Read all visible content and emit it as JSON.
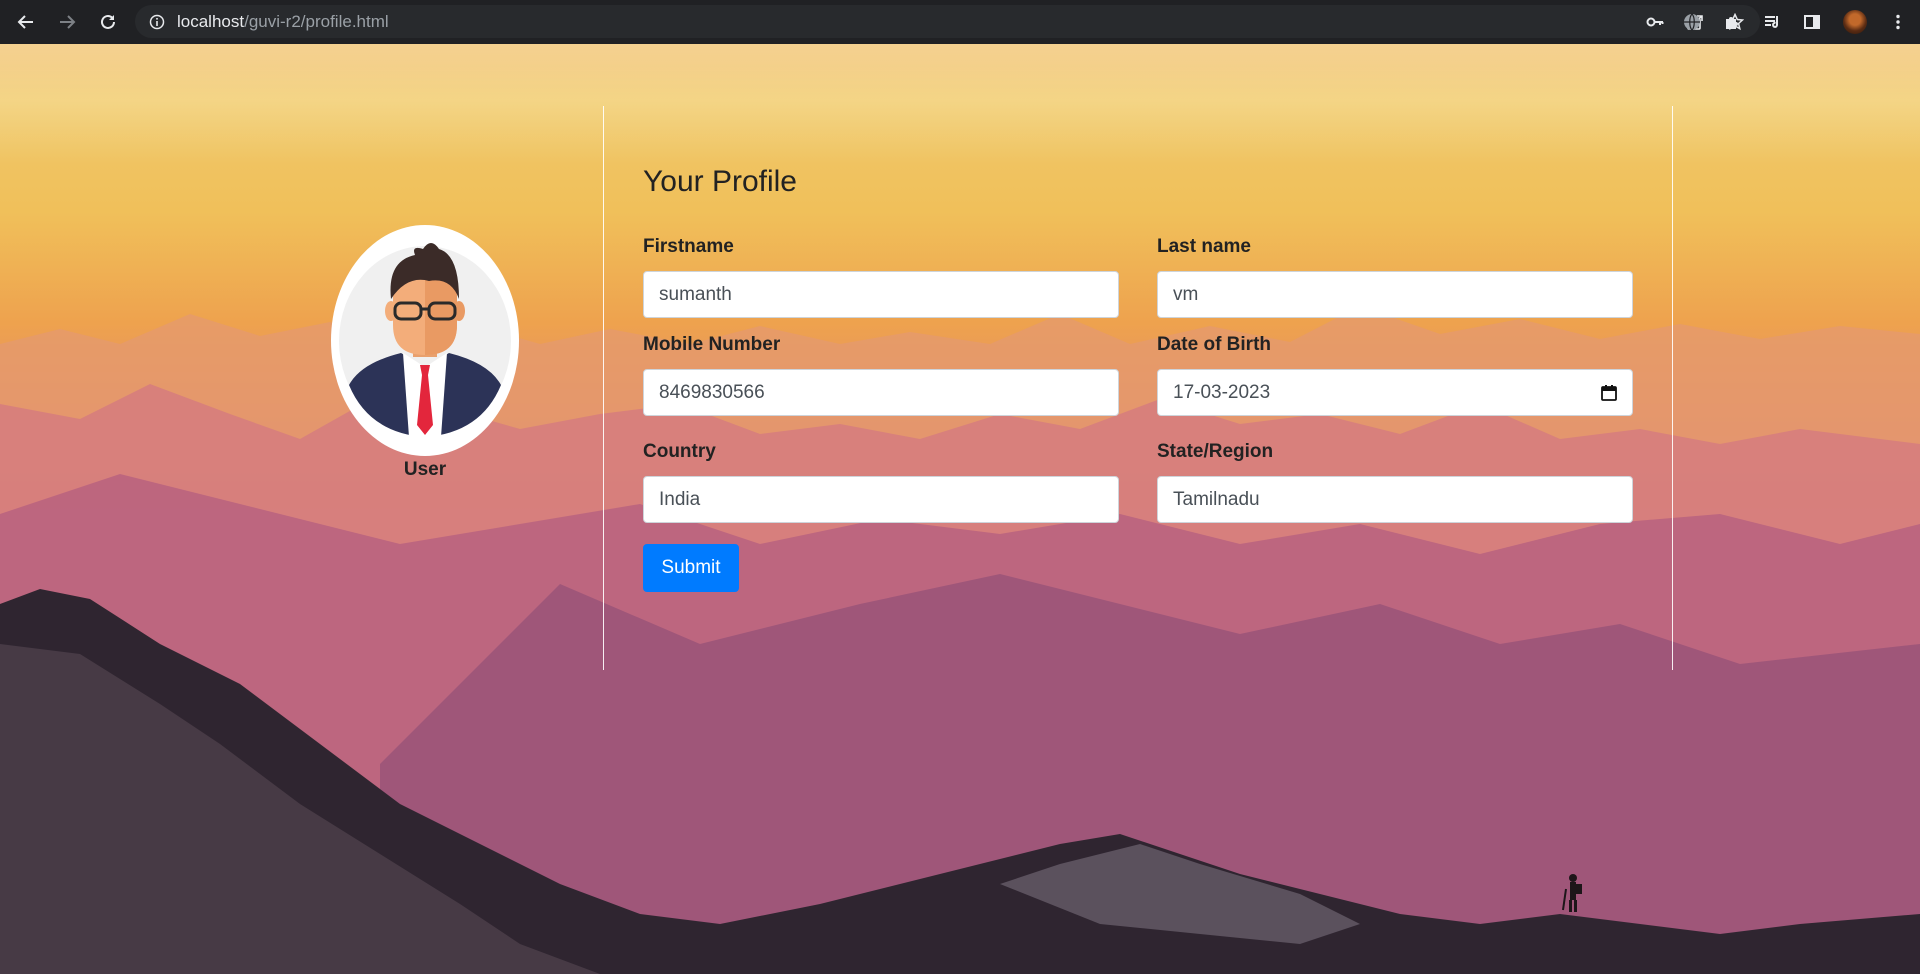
{
  "browser": {
    "url_host": "localhost",
    "url_path": "/guvi-r2/profile.html"
  },
  "profile": {
    "name_label": "User"
  },
  "form": {
    "title": "Your Profile",
    "firstname_label": "Firstname",
    "firstname_value": "sumanth",
    "lastname_label": "Last name",
    "lastname_value": "vm",
    "mobile_label": "Mobile Number",
    "mobile_value": "8469830566",
    "dob_label": "Date of Birth",
    "dob_value": "17-03-2023",
    "country_label": "Country",
    "country_value": "India",
    "state_label": "State/Region",
    "state_value": "Tamilnadu",
    "submit_label": "Submit"
  },
  "colors": {
    "primary": "#007bff",
    "chrome_bg": "#202124"
  }
}
